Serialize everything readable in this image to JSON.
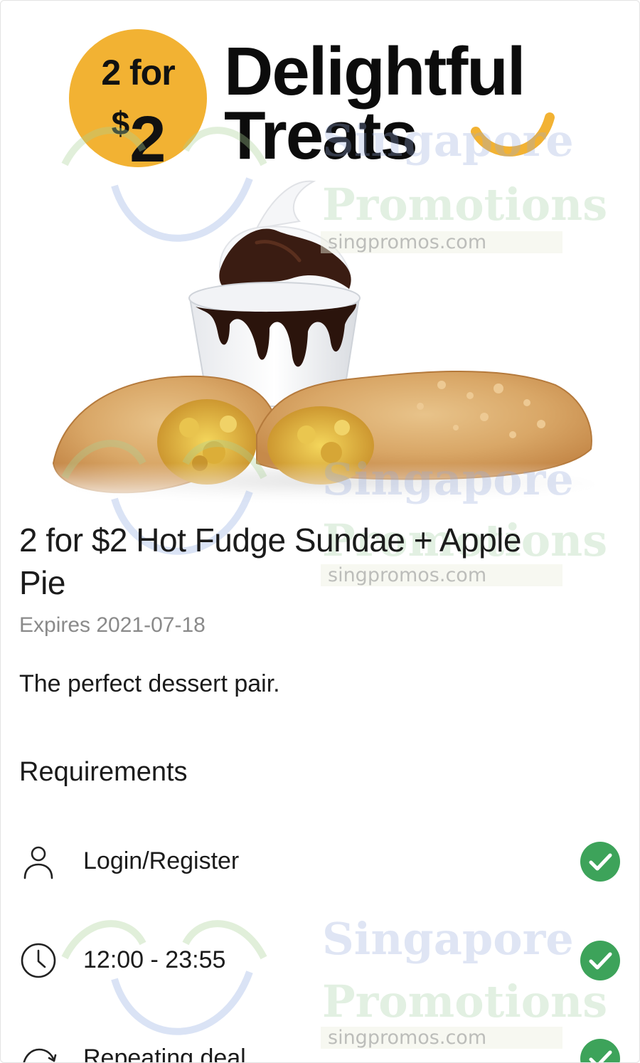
{
  "banner": {
    "badge_line1": "2 for",
    "badge_currency": "$",
    "badge_amount": "2",
    "headline_line1": "Delightful",
    "headline_line2": "Treats",
    "colors": {
      "badge": "#f2b233",
      "smile": "#f2b233",
      "headline": "#0c0c0c"
    }
  },
  "watermark": {
    "word1": "Singapore",
    "word2": "Promotions",
    "url": "singpromos.com"
  },
  "offer": {
    "title": "2 for $2 Hot Fudge Sundae + Apple Pie",
    "expiry": "Expires 2021-07-18",
    "description": "The perfect dessert pair."
  },
  "requirements": {
    "heading": "Requirements",
    "items": [
      {
        "icon": "user-icon",
        "label": "Login/Register",
        "status": "met"
      },
      {
        "icon": "clock-icon",
        "label": "12:00 - 23:55",
        "status": "met"
      },
      {
        "icon": "repeat-icon",
        "label": "Repeating deal",
        "status": "met"
      }
    ],
    "check_color": "#3da35a"
  }
}
